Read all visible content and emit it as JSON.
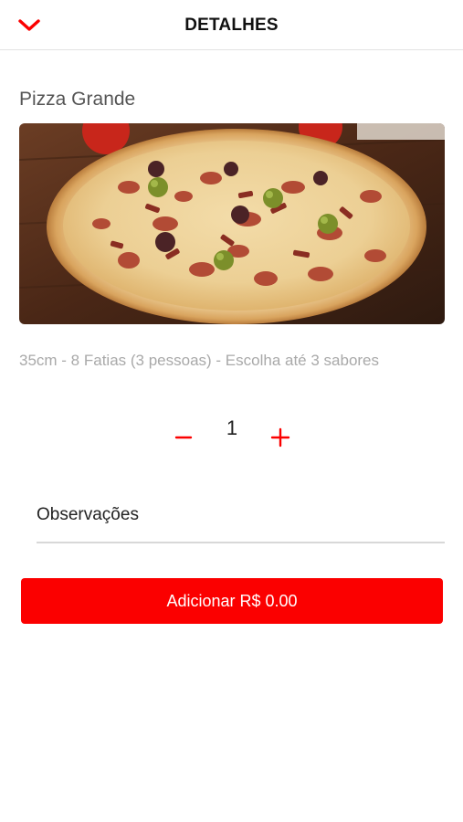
{
  "header": {
    "title": "DETALHES",
    "back_icon": "chevron-down-icon"
  },
  "product": {
    "name": "Pizza Grande",
    "image": "pizza-photo",
    "description": "35cm - 8 Fatias (3 pessoas) - Escolha até 3 sabores"
  },
  "quantity": {
    "value": "1",
    "minus_icon": "minus-icon",
    "plus_icon": "plus-icon"
  },
  "observations": {
    "label": "Observações"
  },
  "add_button": {
    "label": "Adicionar R$ 0.00"
  },
  "colors": {
    "accent": "#fb0000",
    "divider": "#e3e3e3"
  }
}
